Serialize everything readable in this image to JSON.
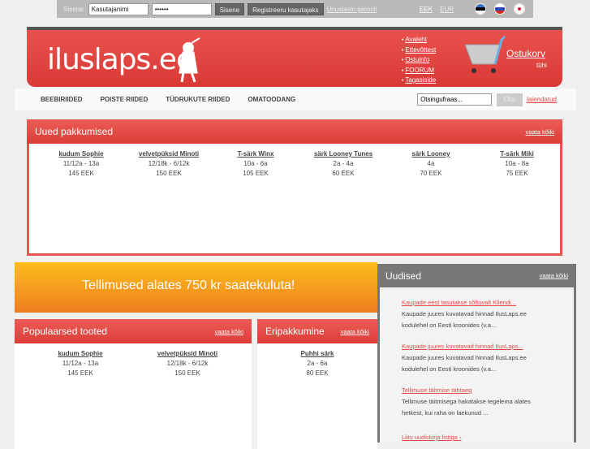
{
  "topbar": {
    "login_label": "Sisene:",
    "username": "Kasutajanimi",
    "password": "••••••",
    "login_button": "Sisene",
    "register_button": "Registreeru kasutajaks",
    "forgot_link": "Unustasin parooli",
    "currencies": [
      "EEK",
      "EUR"
    ]
  },
  "header": {
    "logo": "iluslaps.ee",
    "nav": [
      "Avaleht",
      "Ettevõttest",
      "Ostuinfo",
      "FOORUM",
      "Tagasiside"
    ],
    "cart_label": "Ostukorv",
    "cart_status": "tühi"
  },
  "navbar": {
    "items": [
      "BEEBIRIIDED",
      "POISTE RIIDED",
      "TÜDRUKUTE RIIDED",
      "OMATOODANG"
    ],
    "search_placeholder": "Otsingufraas...",
    "search_button": "Otsi",
    "advanced_link": "laiendatud"
  },
  "new_offers": {
    "title": "Uued pakkumised",
    "more": "vaata kõiki",
    "products": [
      {
        "name": "kudum Sophie",
        "size": "11/12a - 13a",
        "price": "145 EEK"
      },
      {
        "name": "velvetpüksid Minoti",
        "size": "12/18k - 6/12k",
        "price": "150 EEK"
      },
      {
        "name": "T-särk Winx",
        "size": "10a - 6a",
        "price": "105 EEK"
      },
      {
        "name": "särk Looney Tunes",
        "size": "2a - 4a",
        "price": "60 EEK"
      },
      {
        "name": "särk Looney",
        "size": "4a",
        "price": "70 EEK"
      },
      {
        "name": "T-särk Miki",
        "size": "10a - 8a",
        "price": "75 EEK"
      }
    ]
  },
  "banner": {
    "text": "Tellimused alates 750 kr saatekuluta!"
  },
  "popular": {
    "title": "Populaarsed tooted",
    "more": "vaata kõiki",
    "products": [
      {
        "name": "kudum Sophie",
        "size": "11/12a - 13a",
        "price": "145 EEK"
      },
      {
        "name": "velvetpüksid Minoti",
        "size": "12/18k - 6/12k",
        "price": "150 EEK"
      }
    ]
  },
  "special": {
    "title": "Eripakkumine",
    "more": "vaata kõiki",
    "products": [
      {
        "name": "Puhhi särk",
        "size": "2a - 6a",
        "price": "80 EEK"
      }
    ]
  },
  "news": {
    "title": "Uudised",
    "more": "vaata kõiki",
    "items": [
      {
        "title": "Kaupade eest tasutakse sõltuvalt Kliendi...",
        "text": "Kaupade juures kuvatavad hinnad IlusLaps.ee kodulehel on Eesti kroonides (v.a..."
      },
      {
        "title": "Kaupade juures kuvatavad hinnad IlusLaps...",
        "text": "Kaupade juures kuvatavad hinnad IlusLaps.ee kodulehel on Eesti kroonides (v.a..."
      },
      {
        "title": "Tellimuse täitmise tähtaeg",
        "text": "Tellimuse täitmisega hakatakse tegelema alates hetkest, kui raha on laekunud ..."
      }
    ],
    "subscribe": "Liitu uudiskirja listiga ›"
  }
}
